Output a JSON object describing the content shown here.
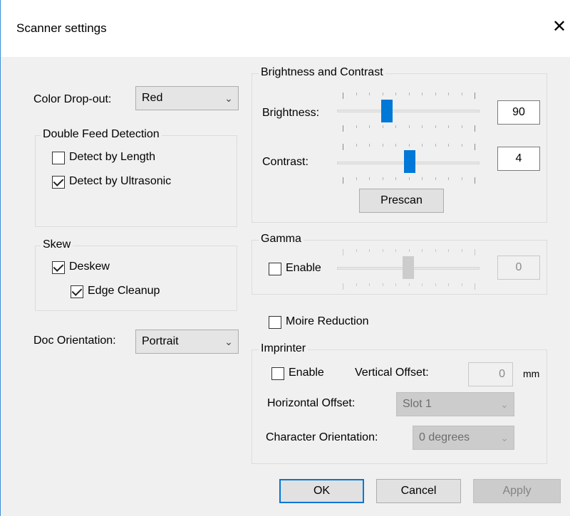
{
  "window": {
    "title": "Scanner settings",
    "close_glyph": "✕"
  },
  "color_dropout": {
    "label": "Color Drop-out:",
    "value": "Red"
  },
  "double_feed": {
    "title": "Double Feed Detection",
    "detect_length": {
      "label": "Detect by Length",
      "checked": false
    },
    "detect_ultrasonic": {
      "label": "Detect by Ultrasonic",
      "checked": true
    }
  },
  "skew": {
    "title": "Skew",
    "deskew": {
      "label": "Deskew",
      "checked": true
    },
    "edge_cleanup": {
      "label": "Edge Cleanup",
      "checked": true
    }
  },
  "doc_orientation": {
    "label": "Doc Orientation:",
    "value": "Portrait"
  },
  "brightness_contrast": {
    "title": "Brightness and Contrast",
    "brightness": {
      "label": "Brightness:",
      "value": "90",
      "fraction": 0.35
    },
    "contrast": {
      "label": "Contrast:",
      "value": "4",
      "fraction": 0.51
    },
    "prescan_label": "Prescan"
  },
  "gamma": {
    "title": "Gamma",
    "enable": {
      "label": "Enable",
      "checked": false
    },
    "value": "0",
    "fraction": 0.5
  },
  "moire": {
    "label": "Moire Reduction",
    "checked": false
  },
  "imprinter": {
    "title": "Imprinter",
    "enable": {
      "label": "Enable",
      "checked": false
    },
    "vertical_offset": {
      "label": "Vertical Offset:",
      "value": "0",
      "unit": "mm"
    },
    "horizontal_offset": {
      "label": "Horizontal Offset:",
      "value": "Slot 1"
    },
    "character_orientation": {
      "label": "Character Orientation:",
      "value": "0 degrees"
    }
  },
  "buttons": {
    "ok": "OK",
    "cancel": "Cancel",
    "apply": "Apply"
  },
  "icons": {
    "chevron": "chevron-down-icon",
    "check": "checkmark-icon",
    "close": "close-icon"
  },
  "colors": {
    "accent": "#0078d7",
    "window_border": "#3c8fd8"
  }
}
